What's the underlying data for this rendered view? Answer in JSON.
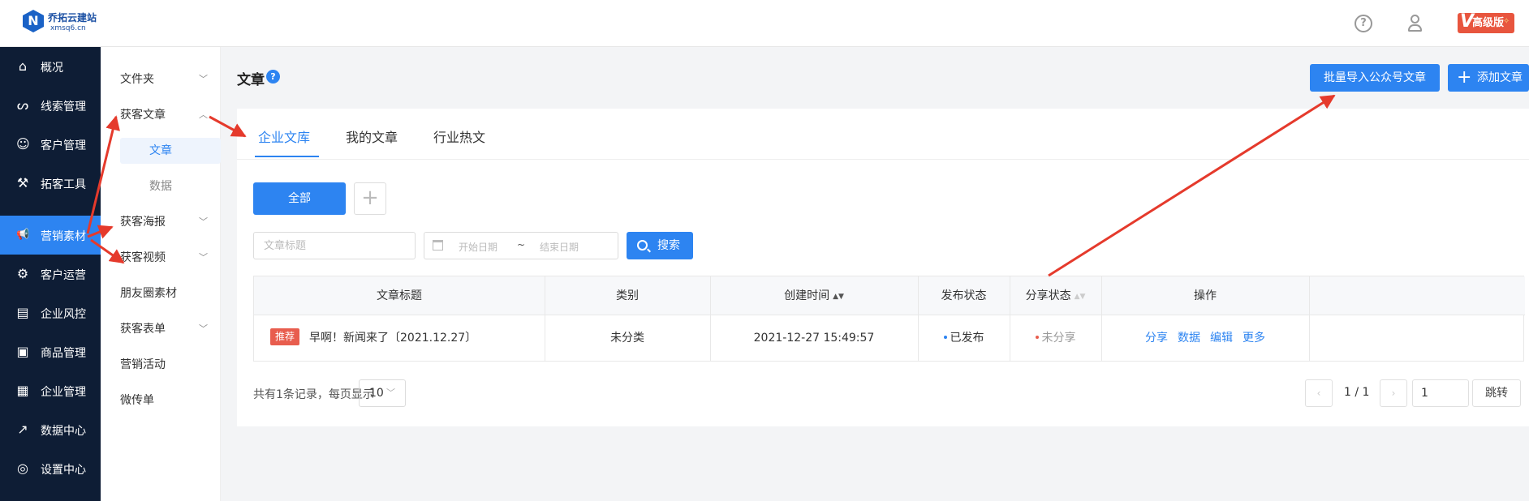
{
  "header": {
    "logo_letter": "N",
    "brand_name": "乔拓云建站",
    "brand_sub": "xmsq6.cn",
    "help_glyph": "?",
    "vip_label": "高级版",
    "vip_v": "V",
    "vip_sparkle": "✧"
  },
  "sidebar": {
    "items": [
      {
        "label": "概况",
        "icon": "home-icon",
        "glyph": "⌂"
      },
      {
        "label": "线索管理",
        "icon": "leads-icon",
        "glyph": "ᔕ"
      },
      {
        "label": "客户管理",
        "icon": "customers-icon",
        "glyph": "☺"
      },
      {
        "label": "拓客工具",
        "icon": "handshake-icon",
        "glyph": "⚒"
      },
      {
        "label": "营销素材",
        "icon": "megaphone-icon",
        "glyph": "📢",
        "active": true
      },
      {
        "label": "客户运营",
        "icon": "operations-icon",
        "glyph": "⚙"
      },
      {
        "label": "企业风控",
        "icon": "risk-icon",
        "glyph": "▤"
      },
      {
        "label": "商品管理",
        "icon": "products-icon",
        "glyph": "▣"
      },
      {
        "label": "企业管理",
        "icon": "briefcase-icon",
        "glyph": "▦"
      },
      {
        "label": "数据中心",
        "icon": "chart-icon",
        "glyph": "↗"
      },
      {
        "label": "设置中心",
        "icon": "settings-icon",
        "glyph": "◎"
      }
    ]
  },
  "subnav": {
    "items": [
      {
        "label": "文件夹",
        "chevron": "﹀"
      },
      {
        "label": "获客文章",
        "chevron": "︿"
      },
      {
        "label": "文章"
      },
      {
        "label": "数据"
      },
      {
        "label": "获客海报",
        "chevron": "﹀"
      },
      {
        "label": "获客视频",
        "chevron": "﹀"
      },
      {
        "label": "朋友圈素材"
      },
      {
        "label": "获客表单",
        "chevron": "﹀"
      },
      {
        "label": "营销活动"
      },
      {
        "label": "微传单"
      }
    ]
  },
  "page": {
    "title": "文章",
    "help_glyph": "?",
    "import_button": "批量导入公众号文章",
    "add_button": "添加文章",
    "add_glyph": "+"
  },
  "tabs": [
    "企业文库",
    "我的文章",
    "行业热文"
  ],
  "filters": {
    "all_button": "全部",
    "add_category_glyph": "+",
    "title_placeholder": "文章标题",
    "date_start_placeholder": "开始日期",
    "date_separator": "~",
    "date_end_placeholder": "结束日期",
    "search_button": "搜索"
  },
  "table": {
    "columns": [
      "文章标题",
      "类别",
      "创建时间",
      "发布状态",
      "分享状态",
      "操作"
    ],
    "sort_glyph": "▲▼",
    "rows": [
      {
        "tag": "推荐",
        "title": "早啊！新闻来了〔2021.12.27〕",
        "category": "未分类",
        "created": "2021-12-27 15:49:57",
        "publish_status": "已发布",
        "share_status": "未分享",
        "actions": [
          "分享",
          "数据",
          "编辑",
          "更多"
        ]
      }
    ]
  },
  "pagination": {
    "total_text": "共有1条记录，每页显示",
    "page_size": "10",
    "page_size_chevron": "﹀",
    "prev_glyph": "‹",
    "page_info": "1 / 1",
    "next_glyph": "›",
    "jump_value": "1",
    "jump_button": "跳转"
  },
  "colors": {
    "primary": "#2d84f1",
    "sidebar_bg": "#0e1d35",
    "tag_bg": "#e85d4e",
    "published_dot": "#2d84f1",
    "unshared_dot": "#e85d4e",
    "annotation_arrow": "#e53a2c"
  }
}
